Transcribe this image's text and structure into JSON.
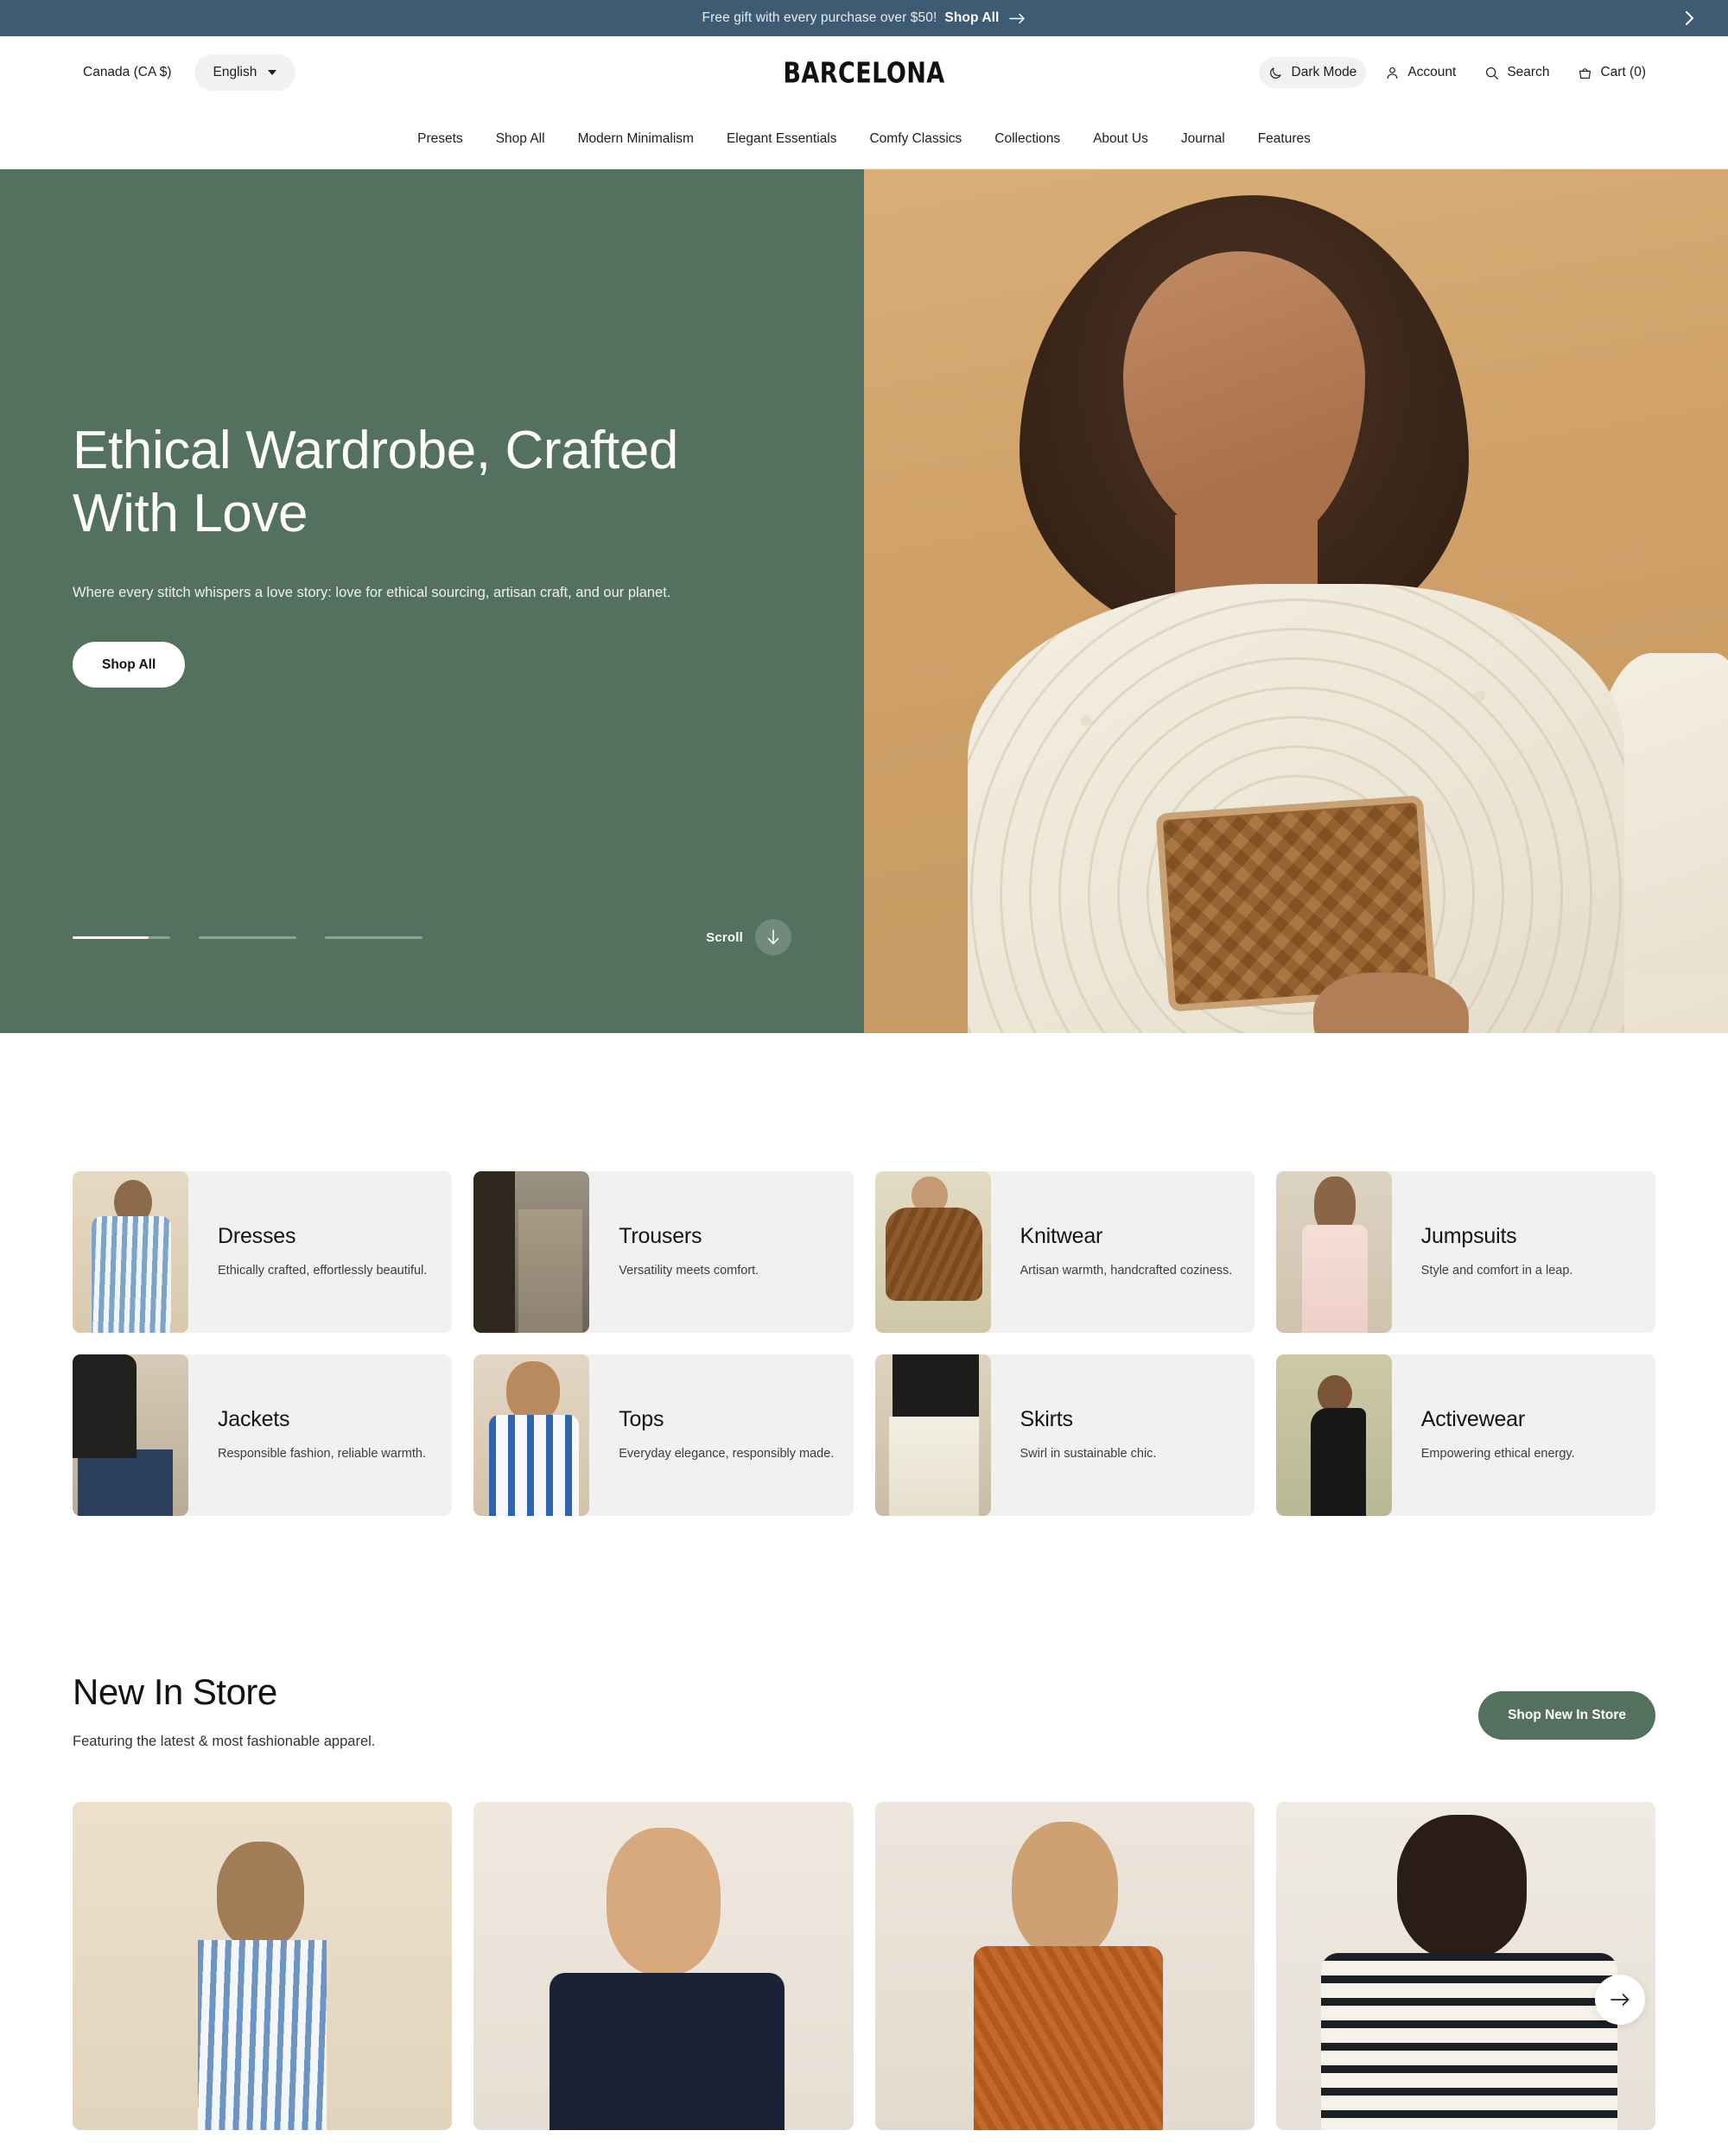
{
  "announcement": {
    "text": "Free gift with every purchase over $50!",
    "link_label": "Shop All",
    "arrow_icon": "arrow-right-icon",
    "next_icon": "chevron-right-icon"
  },
  "header": {
    "region": "Canada (CA $)",
    "language": "English",
    "logo": "BARCELONA",
    "actions": [
      {
        "label": "Dark Mode",
        "icon": "moon-icon"
      },
      {
        "label": "Account",
        "icon": "user-icon"
      },
      {
        "label": "Search",
        "icon": "search-icon"
      },
      {
        "label": "Cart (0)",
        "icon": "cart-icon"
      }
    ]
  },
  "nav": {
    "items": [
      "Presets",
      "Shop All",
      "Modern Minimalism",
      "Elegant Essentials",
      "Comfy Classics",
      "Collections",
      "About Us",
      "Journal",
      "Features"
    ]
  },
  "hero": {
    "title": "Ethical Wardrobe, Crafted With Love",
    "subtitle": "Where every stitch whispers a love story: love for ethical sourcing, artisan craft, and our planet.",
    "cta": "Shop All",
    "scroll_label": "Scroll",
    "scroll_icon": "arrow-down-icon",
    "slide_count": 3,
    "active_slide": 1,
    "background_color": "#54705e"
  },
  "categories": [
    {
      "name": "Dresses",
      "desc": "Ethically crafted, effortlessly beautiful."
    },
    {
      "name": "Trousers",
      "desc": "Versatility meets comfort."
    },
    {
      "name": "Knitwear",
      "desc": "Artisan warmth, handcrafted coziness."
    },
    {
      "name": "Jumpsuits",
      "desc": "Style and comfort in a leap."
    },
    {
      "name": "Jackets",
      "desc": "Responsible fashion, reliable warmth."
    },
    {
      "name": "Tops",
      "desc": "Everyday elegance, responsibly made."
    },
    {
      "name": "Skirts",
      "desc": "Swirl in sustainable chic."
    },
    {
      "name": "Activewear",
      "desc": "Empowering ethical energy."
    }
  ],
  "new_in_store": {
    "title": "New In Store",
    "subtitle": "Featuring the latest & most fashionable apparel.",
    "cta": "Shop New In Store",
    "next_icon": "arrow-right-icon",
    "cta_color": "#54705e"
  },
  "colors": {
    "announcement_bg": "#3e5b74",
    "hero_green": "#54705e",
    "card_bg": "#f1f2f0",
    "page_bg": "#ffffff"
  }
}
